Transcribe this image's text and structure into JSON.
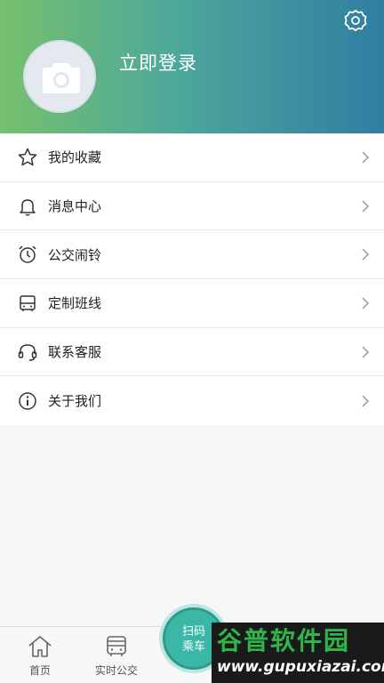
{
  "header": {
    "login_label": "立即登录"
  },
  "menu": {
    "items": [
      {
        "label": "我的收藏",
        "icon": "star-icon"
      },
      {
        "label": "消息中心",
        "icon": "bell-icon"
      },
      {
        "label": "公交闹铃",
        "icon": "alarm-clock-icon"
      },
      {
        "label": "定制班线",
        "icon": "bus-front-icon"
      },
      {
        "label": "联系客服",
        "icon": "headset-icon"
      },
      {
        "label": "关于我们",
        "icon": "info-icon"
      }
    ]
  },
  "tabbar": {
    "home_label": "首页",
    "realtime_label": "实时公交",
    "scan_line1": "扫码",
    "scan_line2": "乘车"
  },
  "watermark": {
    "line1": "谷普软件园",
    "line2": "www.gupuxiazai.com"
  },
  "colors": {
    "header_start": "#76c06d",
    "header_end": "#2f7ea3",
    "scan_button": "#3bb7a6",
    "watermark_green": "#2fb54a"
  }
}
